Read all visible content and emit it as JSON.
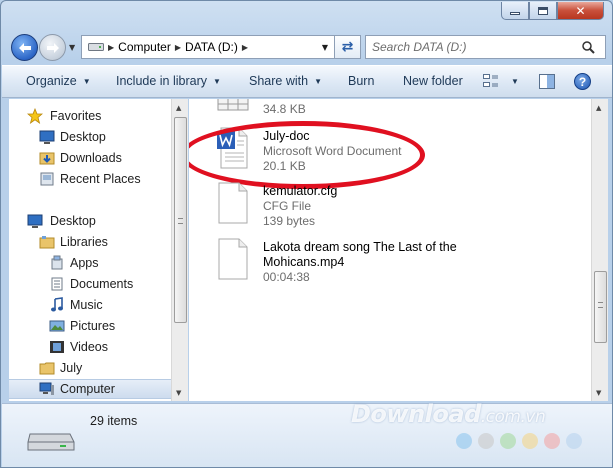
{
  "address": {
    "breadcrumbs": [
      "Computer",
      "DATA (D:)"
    ]
  },
  "search": {
    "placeholder": "Search DATA (D:)"
  },
  "toolbar": {
    "organize": "Organize",
    "include_in_library": "Include in library",
    "share_with": "Share with",
    "burn": "Burn",
    "new_folder": "New folder",
    "help": "?"
  },
  "navpane": {
    "favorites": "Favorites",
    "desktop_fav": "Desktop",
    "downloads": "Downloads",
    "recent_places": "Recent Places",
    "desktop": "Desktop",
    "libraries": "Libraries",
    "apps": "Apps",
    "documents": "Documents",
    "music": "Music",
    "pictures": "Pictures",
    "videos": "Videos",
    "july": "July",
    "computer": "Computer"
  },
  "files": [
    {
      "name": "",
      "type": "",
      "size": "34.8 KB",
      "icon": "table-file-icon"
    },
    {
      "name": "July-doc",
      "type": "Microsoft Word Document",
      "size": "20.1 KB",
      "icon": "word-document-icon"
    },
    {
      "name": "kemulator.cfg",
      "type": "CFG File",
      "size": "139 bytes",
      "icon": "blank-file-icon"
    },
    {
      "name": "Lakota dream song The Last of the Mohicans.mp4",
      "type": "",
      "size": "00:04:38",
      "icon": "blank-file-icon"
    }
  ],
  "details": {
    "item_count": "29 items"
  },
  "watermark": {
    "brand": "Download",
    "tld": ".com.vn"
  },
  "colors": {
    "highlight_oval": "#e01020",
    "selected_nav": "#cddcee",
    "toolbar_text": "#1e3957"
  }
}
